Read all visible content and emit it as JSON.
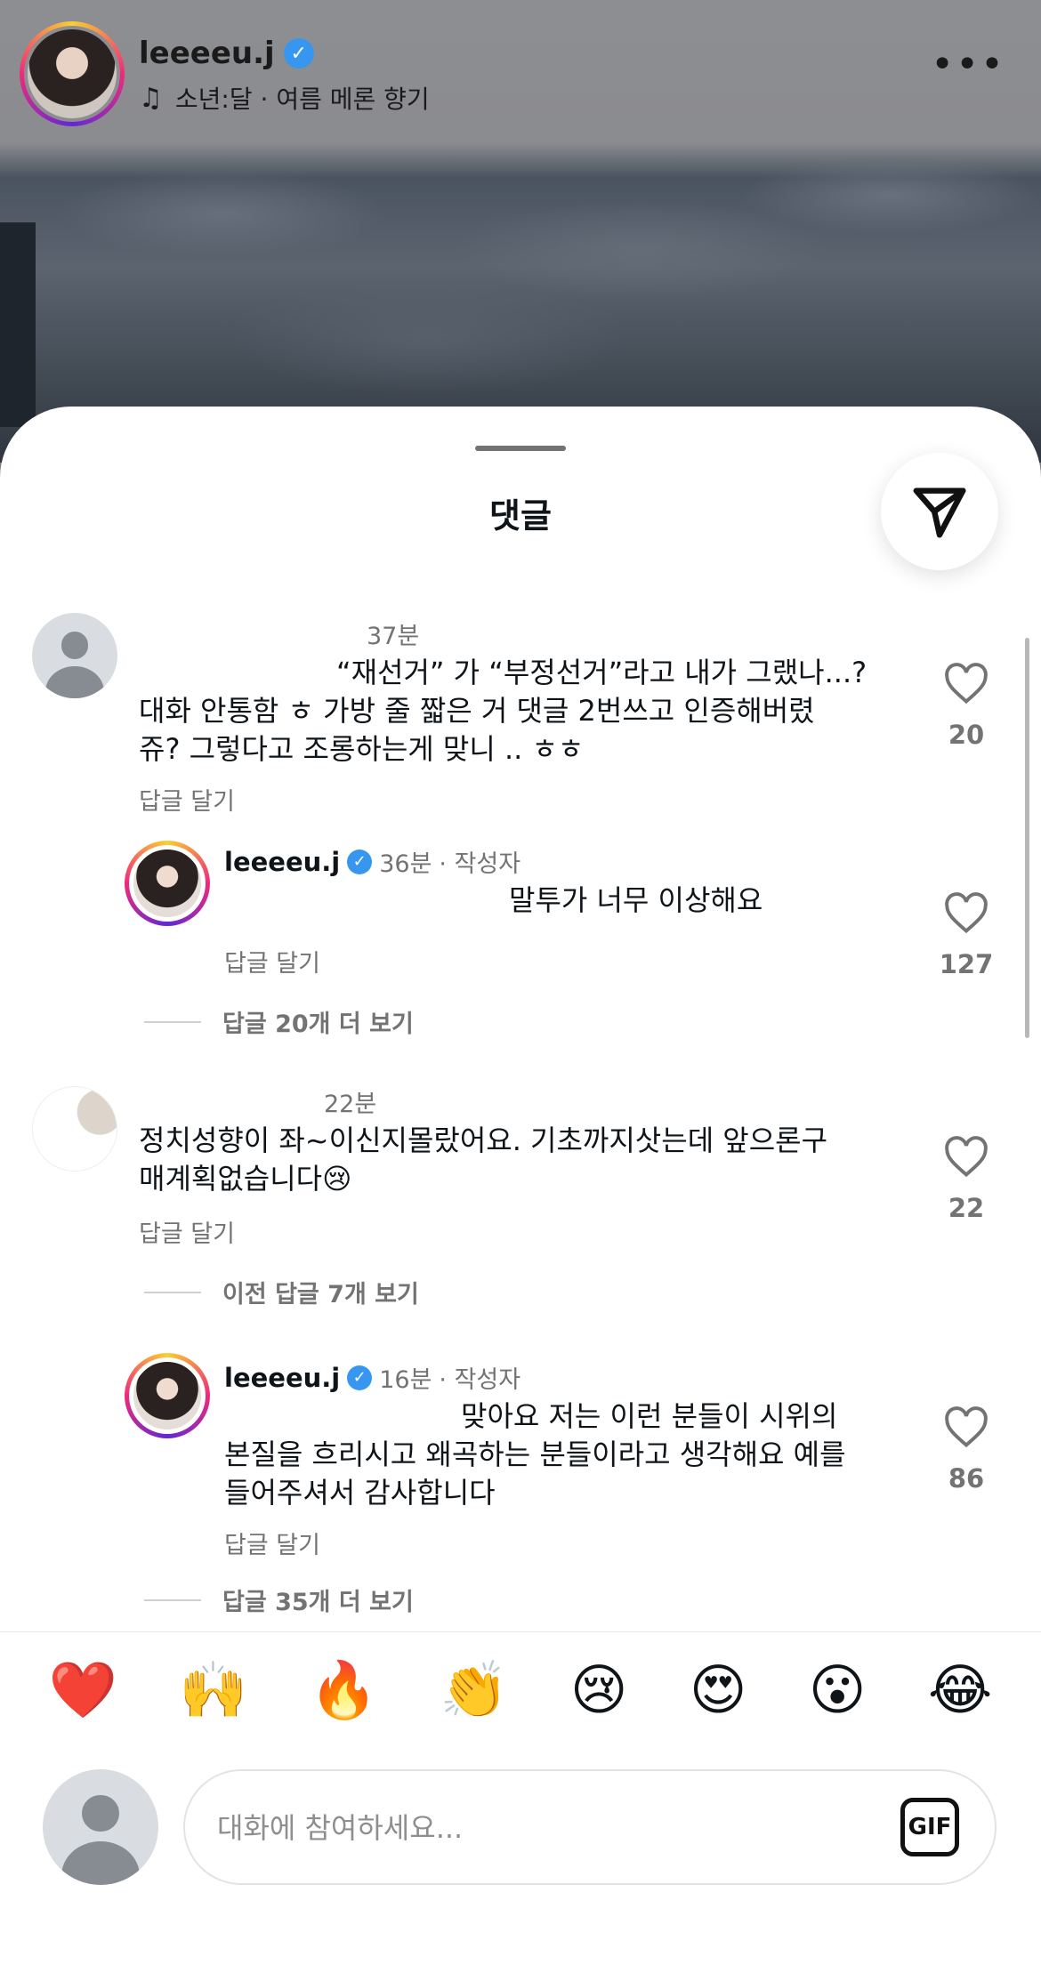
{
  "post": {
    "username": "leeeeu.j",
    "music": "소년:달 · 여름 메론 향기",
    "more": "•••"
  },
  "sheet": {
    "title": "댓글"
  },
  "comments": [
    {
      "time": "37분",
      "text_line1": "“재선거” 가 “부정선거”라고 내가 그랬나...?",
      "text_line2": "대화 안통함 ㅎ 가방 줄 짧은 거 댓글 2번쓰고 인증해버렸",
      "text_line3": "쥬? 그렇다고 조롱하는게 맞니 .. ㅎㅎ",
      "reply": "답글 달기",
      "likes": "20"
    },
    {
      "username": "leeeeu.j",
      "time": "36분",
      "author_tag": "· 작성자",
      "text_line1": "말투가 너무 이상해요",
      "reply": "답글 달기",
      "likes": "127",
      "more_replies": "답글 20개 더 보기"
    },
    {
      "time": "22분",
      "text_line1": "정치성향이 좌~이신지몰랐어요.  기초까지삿는데 앞으론구",
      "text_line2": "매계획없습니다😢",
      "reply": "답글 달기",
      "likes": "22",
      "more_replies": "이전 답글 7개 보기"
    },
    {
      "username": "leeeeu.j",
      "time": "16분",
      "author_tag": "· 작성자",
      "text_line1": "맞아요 저는 이런 분들이 시위의",
      "text_line2": "본질을 흐리시고 왜곡하는 분들이라고 생각해요 예를",
      "text_line3": "들어주셔서 감사합니다",
      "reply": "답글 달기",
      "likes": "86",
      "more_replies": "답글 35개 더 보기"
    }
  ],
  "emoji_bar": [
    "❤️",
    "🙌",
    "🔥",
    "👏",
    "😢",
    "😍",
    "😮",
    "😂"
  ],
  "composer": {
    "placeholder": "대화에 참여하세요...",
    "gif_label": "GIF"
  }
}
